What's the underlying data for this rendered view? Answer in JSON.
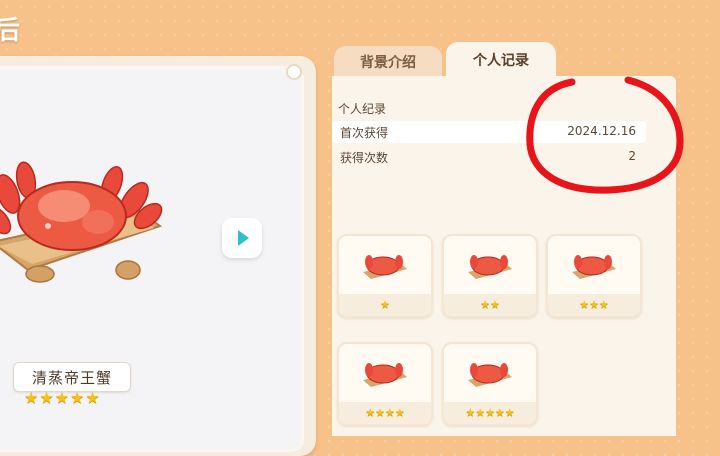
{
  "header": {
    "title_fragment": "后"
  },
  "dish": {
    "name": "清蒸帝王蟹",
    "stars": "★★★★★"
  },
  "tabs": [
    {
      "label": "背景介绍",
      "active": false
    },
    {
      "label": "个人记录",
      "active": true
    }
  ],
  "record": {
    "section_title": "个人纪录",
    "rows": [
      {
        "label": "首次获得",
        "value": "2024.12.16"
      },
      {
        "label": "获得次数",
        "value": "2"
      }
    ]
  },
  "tiers": [
    {
      "stars": "★"
    },
    {
      "stars": "★★"
    },
    {
      "stars": "★★★"
    },
    {
      "stars": "★★★★"
    },
    {
      "stars": "★★★★★"
    }
  ],
  "colors": {
    "background": "#f7c28a",
    "panel": "#fbf4ea",
    "star": "#f4c21c",
    "annotation": "#e8141a",
    "play_accent": "#2ec0c6"
  },
  "icons": {
    "play": "play-icon",
    "dish": "king-crab-dish-icon"
  }
}
